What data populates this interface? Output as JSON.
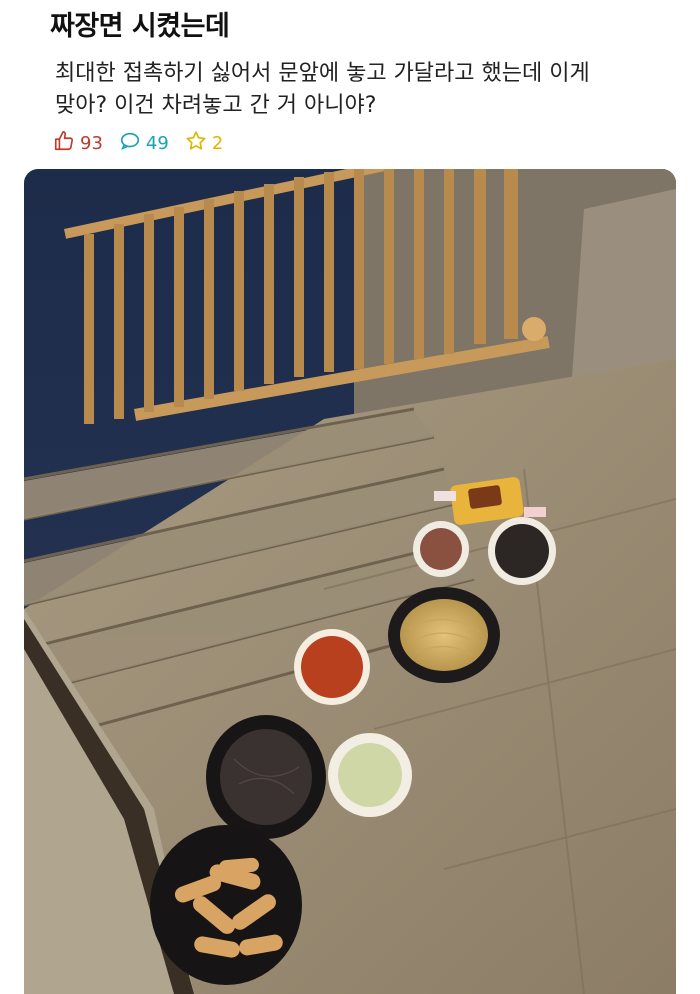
{
  "post": {
    "title": "짜장면 시켰는데",
    "body_line1": "최대한 접촉하기 싫어서 문앞에 놓고 가달라고 했는데 이게",
    "body_line2": "맞아? 이건 차려놓고 간 거 아니야?"
  },
  "stats": {
    "likes": "93",
    "comments": "49",
    "scraps": "2"
  },
  "colors": {
    "like": "#c0392b",
    "comment": "#16a2b8",
    "scrap": "#e0b400"
  },
  "icons": [
    "thumbs-up-icon",
    "comment-bubble-icon",
    "star-icon"
  ]
}
